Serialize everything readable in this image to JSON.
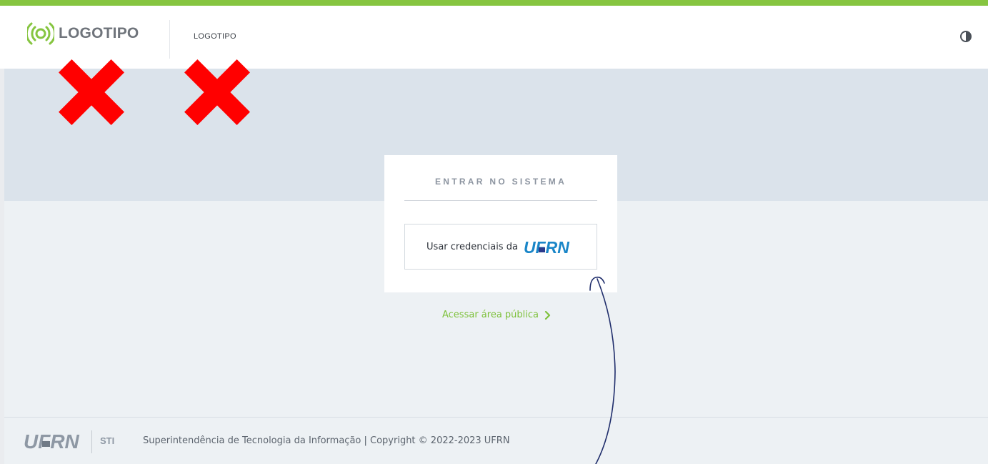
{
  "header": {
    "logo_text": "LOGOTIPO",
    "secondary_label": "LOGOTIPO",
    "theme_toggle_icon": "contrast-icon"
  },
  "login_card": {
    "title": "ENTRAR NO SISTEMA",
    "credentials_button_label": "Usar credenciais da",
    "credentials_logo_text": "UFRN"
  },
  "public_link": {
    "label": "Acessar área pública",
    "icon": "chevron-right-icon"
  },
  "footer": {
    "logo_text": "UFRN",
    "unit": "STI",
    "copyright": "Superintendência de Tecnologia da Informação | Copyright © 2022-2023 UFRN"
  },
  "annotations": {
    "marks": [
      "red-x-mark",
      "red-x-mark"
    ],
    "arrow": "hand-drawn-arrow"
  },
  "colors": {
    "accent_green": "#86c540",
    "link_green": "#7ec13b",
    "hero_bg": "#dbe3eb",
    "main_bg": "#edf1f4",
    "ufrn_blue": "#1a86c8",
    "ufrn_dark_blue": "#2b3a8c",
    "annotation_red": "#ff0000",
    "annotation_ink": "#1f2d6b"
  }
}
